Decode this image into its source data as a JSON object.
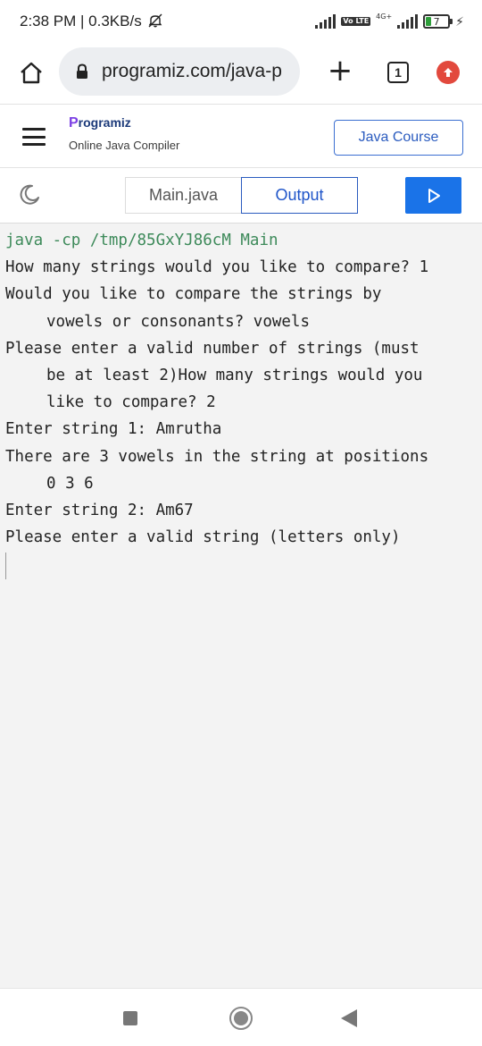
{
  "status_bar": {
    "time": "2:38 PM | 0.3KB/s",
    "volte_label": "Vo LTE",
    "network_label": "4G+",
    "battery_level": "7"
  },
  "browser": {
    "url": "programiz.com/java-p",
    "tab_count": "1"
  },
  "site_header": {
    "brand_mark": "P",
    "brand_name": "rogramiz",
    "subtitle": "Online Java Compiler",
    "course_button": "Java Course"
  },
  "toolbar": {
    "tab_main": "Main.java",
    "tab_output": "Output"
  },
  "console": {
    "command": "java -cp /tmp/85GxYJ86cM Main",
    "lines": [
      "How many strings would you like to compare? 1",
      "Would you like to compare the strings by",
      "vowels or consonants? vowels",
      "Please enter a valid number of strings (must",
      "be at least 2)How many strings would you",
      "like to compare? 2",
      "Enter string 1: Amrutha",
      "There are 3 vowels in the string at positions",
      "0 3 6",
      "Enter string 2: Am67",
      "Please enter a valid string (letters only)"
    ]
  },
  "icons": {
    "home": "home-icon",
    "lock": "lock-icon",
    "add_tab": "plus-icon",
    "update": "arrow-up-icon",
    "menu": "hamburger-icon",
    "theme": "moon-icon",
    "run": "play-icon",
    "muted": "bell-off-icon"
  },
  "colors": {
    "accent": "#1a73e8",
    "command_text": "#3d8a5a",
    "update_badge": "#e2493d",
    "brand_mark": "#7b3fe4",
    "battery_fill": "#2e9e3a"
  }
}
